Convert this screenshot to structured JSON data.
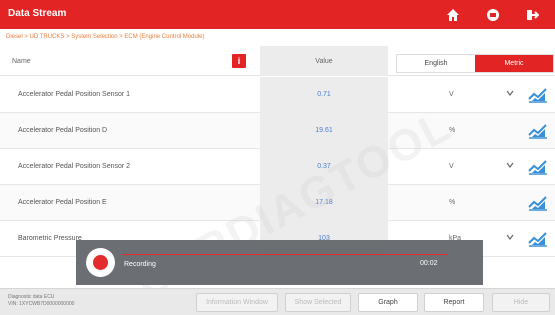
{
  "title": "Data Stream",
  "breadcrumb": "Diesel > UD TRUCKS > System Selection > ECM (Engine Control Module)",
  "header": {
    "name_label": "Name",
    "value_label": "Value",
    "info_label": "i"
  },
  "units_toggle": {
    "english": "English",
    "metric": "Metric",
    "selected": "Metric"
  },
  "rows": [
    {
      "name": "Accelerator Pedal Position Sensor 1",
      "value": "0.71",
      "unit": "V"
    },
    {
      "name": "Accelerator Pedal Position D",
      "value": "19.61",
      "unit": "%"
    },
    {
      "name": "Accelerator Pedal Position Sensor 2",
      "value": "0.37",
      "unit": "V"
    },
    {
      "name": "Accelerator Pedal Position E",
      "value": "17.18",
      "unit": "%"
    },
    {
      "name": "Barometric Pressure",
      "value": "103",
      "unit": "kPa"
    }
  ],
  "recorder": {
    "label": "Recording",
    "time": "00:02"
  },
  "footer": {
    "vin_line1": "Diagnostic data ECU",
    "vin_line2": "VIN: 1XYCWB7D0000000000",
    "buttons": [
      {
        "label": "Information Window",
        "disabled": true
      },
      {
        "label": "Show Selected",
        "disabled": true
      },
      {
        "label": "Graph",
        "disabled": false
      },
      {
        "label": "Report",
        "disabled": false
      },
      {
        "label": "Hide",
        "disabled": true
      }
    ]
  },
  "watermark": "CARDIAGTOOL",
  "colors": {
    "brand_red": "#e32424",
    "value_blue": "#4a7fd0",
    "breadcrumb_orange": "#e9803a"
  },
  "icons": [
    "home-icon",
    "print-icon",
    "exit-icon",
    "chevron-down-icon",
    "graph-icon",
    "record-icon"
  ]
}
